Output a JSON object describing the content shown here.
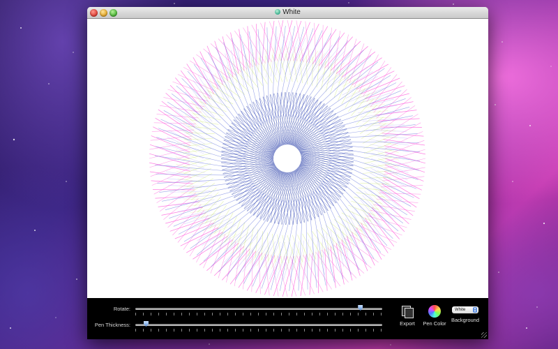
{
  "window": {
    "title": "White"
  },
  "controls": {
    "rotate_label": "Rotate:",
    "rotate_value": 0.92,
    "thickness_label": "Pen Thickness:",
    "thickness_value": 0.02
  },
  "toolbar": {
    "export_label": "Export",
    "export_icon": "export-icon",
    "pen_color_label": "Pen Color",
    "pen_color_icon": "color-wheel-icon",
    "background_label": "Background",
    "background_value": "White"
  },
  "colors": {
    "pen_colors": [
      "#ff4fd8",
      "#b8b0ff",
      "#c8e86a",
      "#6f7fe0",
      "#3b4fb0"
    ]
  }
}
